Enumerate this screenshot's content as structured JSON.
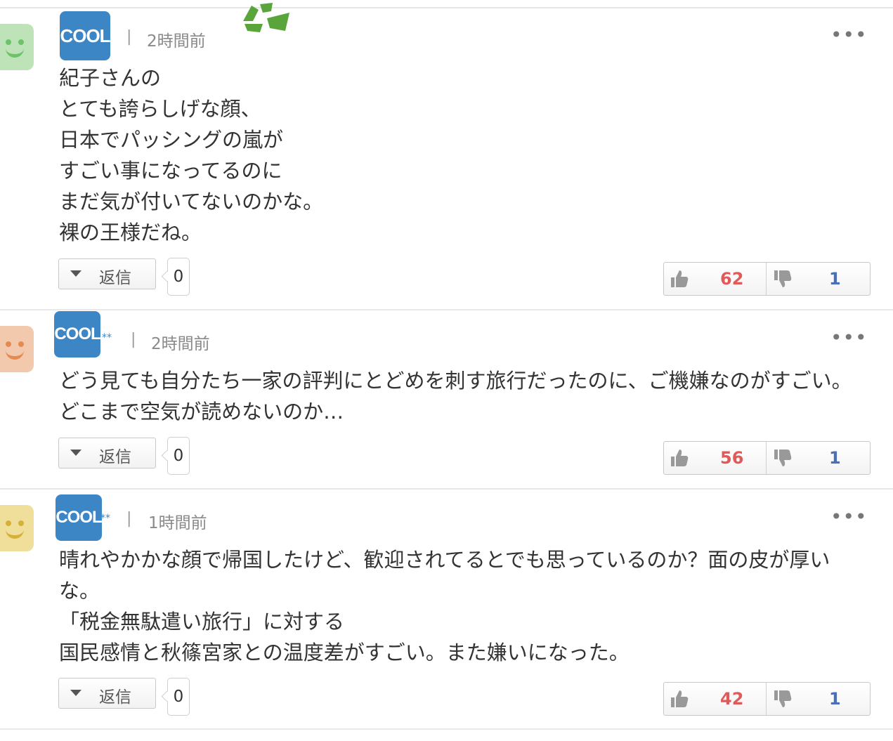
{
  "comments": [
    {
      "author": "COOL",
      "author_suffix": "",
      "time": "2時間前",
      "body": "紀子さんの\nとても誇らしげな顔、\n日本でパッシングの嵐が\nすごい事になってるのに\nまだ気が付いてないのかな。\n裸の王様だね。",
      "reply_label": "返信",
      "reply_count": "0",
      "likes": "62",
      "dislikes": "1",
      "avatar_color": "#bfe3b8",
      "avatar_feature_color": "#6cc36a"
    },
    {
      "author": "COOL",
      "author_suffix": "**",
      "time": "2時間前",
      "body": "どう見ても自分たち一家の評判にとどめを刺す旅行だったのに、ご機嫌なのがすごい。どこまで空気が読めないのか…",
      "reply_label": "返信",
      "reply_count": "0",
      "likes": "56",
      "dislikes": "1",
      "avatar_color": "#f3c9ae",
      "avatar_feature_color": "#e48a52"
    },
    {
      "author": "COOL",
      "author_suffix": "**",
      "time": "1時間前",
      "body": "晴れやかかな顔で帰国したけど、歓迎されてるとでも思っているのか？面の皮が厚いな。\n「税金無駄遣い旅行」に対する\n国民感情と秋篠宮家との温度差がすごい。また嫌いになった。",
      "reply_label": "返信",
      "reply_count": "0",
      "likes": "42",
      "dislikes": "1",
      "avatar_color": "#f0df9a",
      "avatar_feature_color": "#d6b13a"
    }
  ],
  "ui": {
    "more_label": "•••",
    "separator": "|",
    "recycle_icon": "recycle-icon"
  }
}
